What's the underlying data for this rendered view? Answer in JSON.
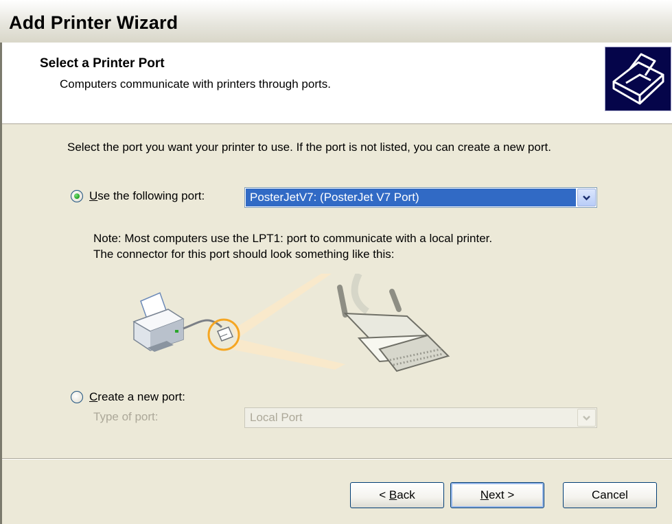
{
  "window": {
    "title": "Add Printer Wizard"
  },
  "header": {
    "title": "Select a Printer Port",
    "subtitle": "Computers communicate with printers through ports.",
    "icon": "printer-wizard-icon"
  },
  "content": {
    "intro": "Select the port you want your printer to use.  If the port is not listed, you can create a new port.",
    "use_port": {
      "label_prefix": "",
      "label_underlined": "U",
      "label_rest": "se the following port:",
      "selected": true,
      "value": "PosterJetV7: (PosterJet V7 Port)"
    },
    "note_line1": "Note: Most computers use the LPT1: port to communicate with a local printer.",
    "note_line2": "The connector for this port should look something like this:",
    "create_port": {
      "label_underlined": "C",
      "label_rest": "reate a new port:",
      "selected": false,
      "type_label": "Type of port:",
      "type_value": "Local Port"
    }
  },
  "footer": {
    "back": {
      "prefix": "< ",
      "underlined": "B",
      "rest": "ack"
    },
    "next": {
      "underlined": "N",
      "rest": "ext >"
    },
    "cancel": "Cancel"
  },
  "colors": {
    "selection": "#316ac5",
    "titlebar_text": "#000000",
    "header_icon_bg": "#05054a",
    "accent_orange": "#f5a623"
  }
}
